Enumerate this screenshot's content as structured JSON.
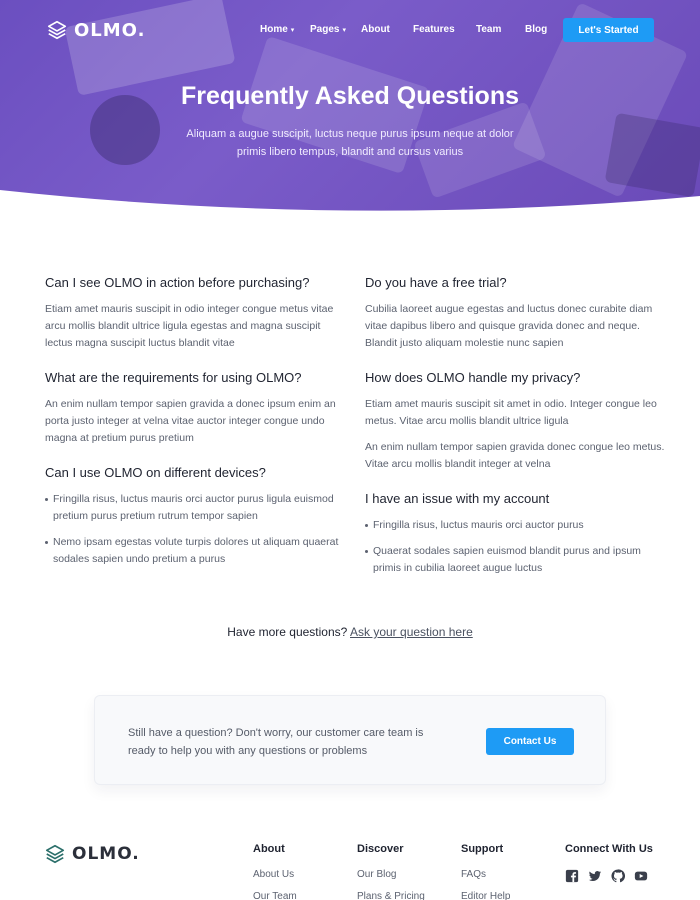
{
  "brand": {
    "name": "OLMO.",
    "accent": "#1e9bf5",
    "hero_color": "#7150c2"
  },
  "nav": {
    "items": [
      {
        "label": "Home",
        "has_dropdown": true
      },
      {
        "label": "Pages",
        "has_dropdown": true
      },
      {
        "label": "About",
        "has_dropdown": false
      },
      {
        "label": "Features",
        "has_dropdown": false
      },
      {
        "label": "Team",
        "has_dropdown": false
      },
      {
        "label": "Blog",
        "has_dropdown": false
      }
    ],
    "cta_label": "Let's Started"
  },
  "hero": {
    "title": "Frequently Asked Questions",
    "subtitle": "Aliquam a augue suscipit, luctus neque purus ipsum neque at dolor primis libero tempus, blandit and cursus varius"
  },
  "faq": {
    "left": [
      {
        "question": "Can I see OLMO in action before purchasing?",
        "answers": [
          "Etiam amet mauris suscipit in odio integer congue metus vitae arcu mollis blandit ultrice ligula egestas and magna suscipit lectus magna suscipit luctus blandit vitae"
        ]
      },
      {
        "question": "What are the requirements for using OLMO?",
        "answers": [
          "An enim nullam tempor sapien gravida a donec ipsum enim an porta justo integer at velna vitae auctor integer congue undo magna at pretium purus pretium"
        ]
      },
      {
        "question": "Can I use OLMO on different devices?",
        "bullets": [
          "Fringilla risus, luctus mauris orci auctor purus ligula euismod pretium purus pretium rutrum tempor sapien",
          "Nemo ipsam egestas volute turpis dolores ut aliquam quaerat sodales sapien undo pretium a purus"
        ]
      }
    ],
    "right": [
      {
        "question": "Do you have a free trial?",
        "answers": [
          "Cubilia laoreet augue egestas and luctus donec curabite diam vitae dapibus libero and quisque gravida donec and neque. Blandit justo aliquam molestie nunc sapien"
        ]
      },
      {
        "question": "How does OLMO handle my privacy?",
        "answers": [
          "Etiam amet mauris suscipit sit amet in odio. Integer congue leo metus. Vitae arcu mollis blandit ultrice ligula",
          "An enim nullam tempor sapien gravida donec congue leo metus. Vitae arcu mollis blandit integer at velna"
        ]
      },
      {
        "question": "I have an issue with my account",
        "bullets": [
          "Fringilla risus, luctus mauris orci auctor purus",
          "Quaerat sodales sapien euismod blandit purus and ipsum primis in cubilia laoreet augue luctus"
        ]
      }
    ]
  },
  "more_questions": {
    "text": "Have more questions?",
    "link_label": "Ask your question here"
  },
  "contact": {
    "text": "Still have a question? Don't worry, our customer care team is ready to help you with any questions or problems",
    "button_label": "Contact Us"
  },
  "footer": {
    "columns": [
      {
        "title": "About",
        "links": [
          "About Us",
          "Our Team"
        ]
      },
      {
        "title": "Discover",
        "links": [
          "Our Blog",
          "Plans & Pricing"
        ]
      },
      {
        "title": "Support",
        "links": [
          "FAQs",
          "Editor Help"
        ]
      }
    ],
    "connect_title": "Connect With Us",
    "social_icons": [
      "facebook-icon",
      "twitter-icon",
      "github-icon",
      "youtube-icon"
    ]
  }
}
